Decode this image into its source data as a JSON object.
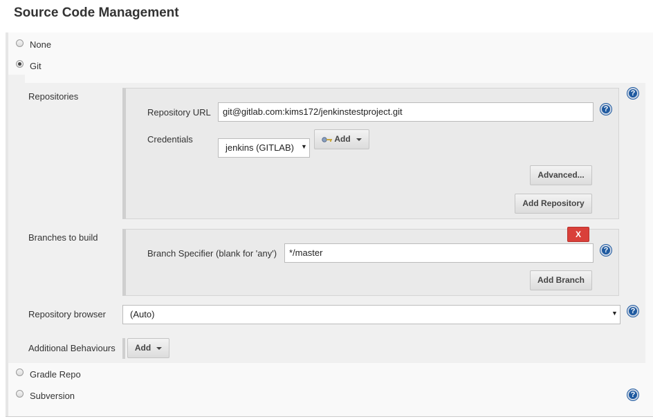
{
  "section_title": "Source Code Management",
  "scm_options": {
    "none": "None",
    "git": "Git",
    "gradle": "Gradle Repo",
    "subversion": "Subversion"
  },
  "selected_scm": "Git",
  "repositories": {
    "label": "Repositories",
    "url_label": "Repository URL",
    "url_value": "git@gitlab.com:kims172/jenkinstestproject.git",
    "credentials_label": "Credentials",
    "credentials_value": "jenkins (GITLAB)",
    "add_label": "Add",
    "advanced_label": "Advanced...",
    "add_repository_label": "Add Repository"
  },
  "branches": {
    "label": "Branches to build",
    "delete_label": "X",
    "specifier_label": "Branch Specifier (blank for 'any')",
    "specifier_value": "*/master",
    "add_branch_label": "Add Branch"
  },
  "repository_browser": {
    "label": "Repository browser",
    "value": "(Auto)"
  },
  "additional_behaviours": {
    "label": "Additional Behaviours",
    "add_label": "Add"
  },
  "help_glyph": "?",
  "dropdown_glyph": "▼",
  "icons": {
    "help": "help-icon",
    "key": "key-icon",
    "dropdown": "chevron-down-icon"
  },
  "colors": {
    "delete": "#d9403a",
    "help": "#1f5aa0"
  }
}
